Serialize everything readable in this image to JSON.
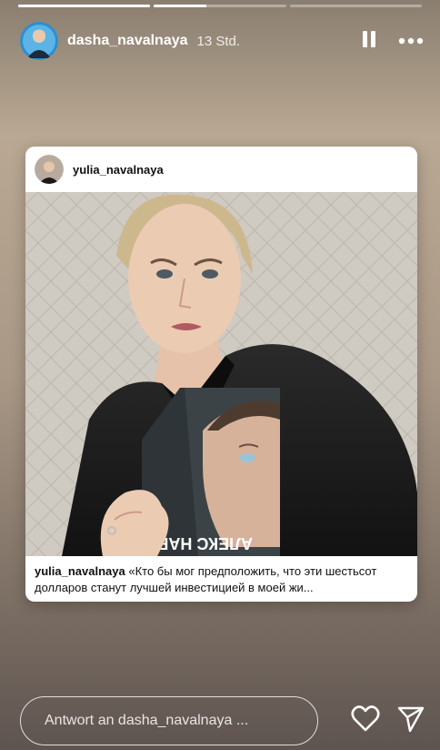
{
  "progress": {
    "segments": [
      {
        "fill": 1.0
      },
      {
        "fill": 0.4
      },
      {
        "fill": 0.0
      }
    ]
  },
  "header": {
    "username": "dasha_navalnaya",
    "time": "13 Std.",
    "pause_icon": "pause-icon",
    "more_icon": "more-horizontal-icon"
  },
  "post": {
    "username": "yulia_navalnaya",
    "book_text": "АЛЕКС НАВАЛЬ",
    "caption_user": "yulia_navalnaya",
    "caption_text": "«Кто бы мог предположить, что эти шестьсот долларов станут лучшей инвестицией в моей жи..."
  },
  "footer": {
    "reply_placeholder": "Antwort an dasha_navalnaya ...",
    "like_icon": "heart-icon",
    "send_icon": "send-icon"
  }
}
